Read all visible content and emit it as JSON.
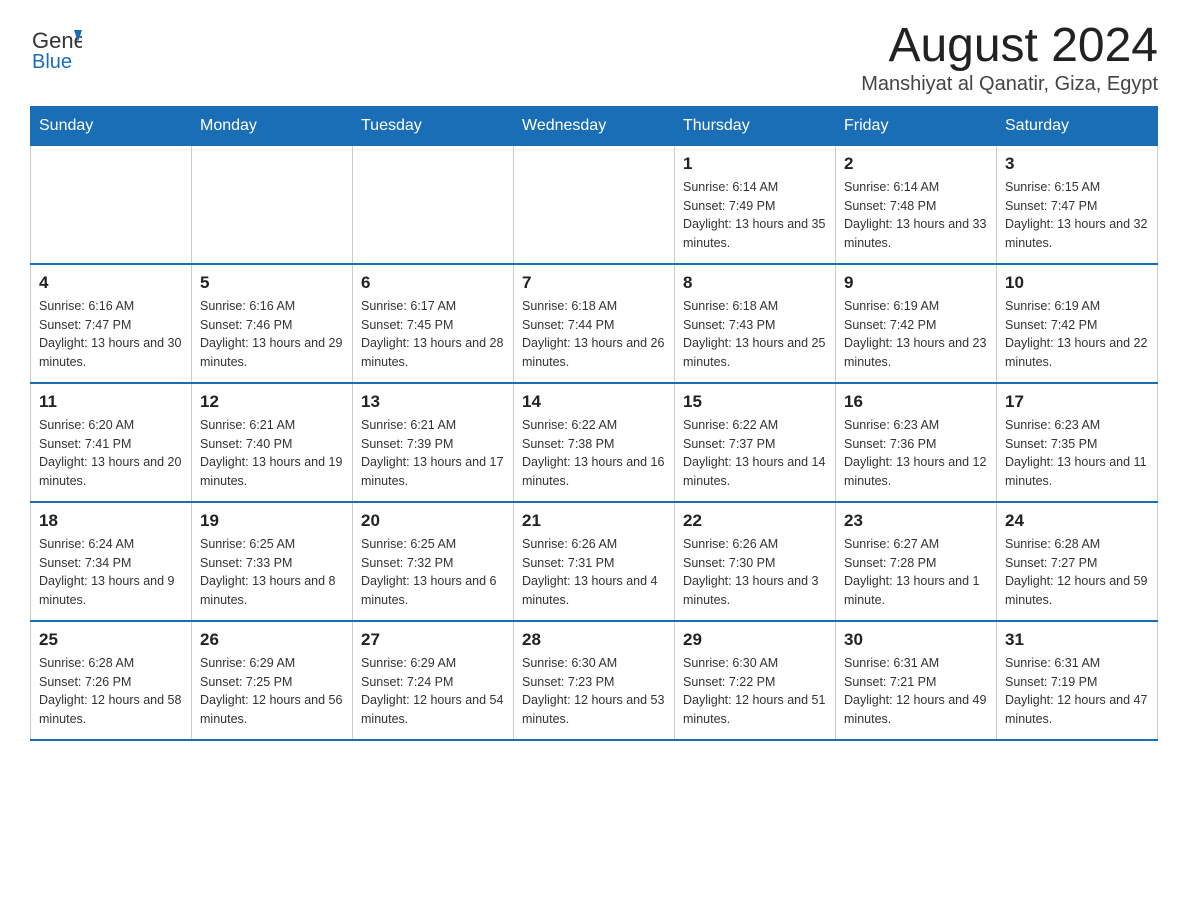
{
  "header": {
    "logo_text_main": "General",
    "logo_text_blue": "Blue",
    "title": "August 2024",
    "subtitle": "Manshiyat al Qanatir, Giza, Egypt"
  },
  "days_of_week": [
    "Sunday",
    "Monday",
    "Tuesday",
    "Wednesday",
    "Thursday",
    "Friday",
    "Saturday"
  ],
  "weeks": [
    [
      {
        "day": "",
        "info": ""
      },
      {
        "day": "",
        "info": ""
      },
      {
        "day": "",
        "info": ""
      },
      {
        "day": "",
        "info": ""
      },
      {
        "day": "1",
        "info": "Sunrise: 6:14 AM\nSunset: 7:49 PM\nDaylight: 13 hours and 35 minutes."
      },
      {
        "day": "2",
        "info": "Sunrise: 6:14 AM\nSunset: 7:48 PM\nDaylight: 13 hours and 33 minutes."
      },
      {
        "day": "3",
        "info": "Sunrise: 6:15 AM\nSunset: 7:47 PM\nDaylight: 13 hours and 32 minutes."
      }
    ],
    [
      {
        "day": "4",
        "info": "Sunrise: 6:16 AM\nSunset: 7:47 PM\nDaylight: 13 hours and 30 minutes."
      },
      {
        "day": "5",
        "info": "Sunrise: 6:16 AM\nSunset: 7:46 PM\nDaylight: 13 hours and 29 minutes."
      },
      {
        "day": "6",
        "info": "Sunrise: 6:17 AM\nSunset: 7:45 PM\nDaylight: 13 hours and 28 minutes."
      },
      {
        "day": "7",
        "info": "Sunrise: 6:18 AM\nSunset: 7:44 PM\nDaylight: 13 hours and 26 minutes."
      },
      {
        "day": "8",
        "info": "Sunrise: 6:18 AM\nSunset: 7:43 PM\nDaylight: 13 hours and 25 minutes."
      },
      {
        "day": "9",
        "info": "Sunrise: 6:19 AM\nSunset: 7:42 PM\nDaylight: 13 hours and 23 minutes."
      },
      {
        "day": "10",
        "info": "Sunrise: 6:19 AM\nSunset: 7:42 PM\nDaylight: 13 hours and 22 minutes."
      }
    ],
    [
      {
        "day": "11",
        "info": "Sunrise: 6:20 AM\nSunset: 7:41 PM\nDaylight: 13 hours and 20 minutes."
      },
      {
        "day": "12",
        "info": "Sunrise: 6:21 AM\nSunset: 7:40 PM\nDaylight: 13 hours and 19 minutes."
      },
      {
        "day": "13",
        "info": "Sunrise: 6:21 AM\nSunset: 7:39 PM\nDaylight: 13 hours and 17 minutes."
      },
      {
        "day": "14",
        "info": "Sunrise: 6:22 AM\nSunset: 7:38 PM\nDaylight: 13 hours and 16 minutes."
      },
      {
        "day": "15",
        "info": "Sunrise: 6:22 AM\nSunset: 7:37 PM\nDaylight: 13 hours and 14 minutes."
      },
      {
        "day": "16",
        "info": "Sunrise: 6:23 AM\nSunset: 7:36 PM\nDaylight: 13 hours and 12 minutes."
      },
      {
        "day": "17",
        "info": "Sunrise: 6:23 AM\nSunset: 7:35 PM\nDaylight: 13 hours and 11 minutes."
      }
    ],
    [
      {
        "day": "18",
        "info": "Sunrise: 6:24 AM\nSunset: 7:34 PM\nDaylight: 13 hours and 9 minutes."
      },
      {
        "day": "19",
        "info": "Sunrise: 6:25 AM\nSunset: 7:33 PM\nDaylight: 13 hours and 8 minutes."
      },
      {
        "day": "20",
        "info": "Sunrise: 6:25 AM\nSunset: 7:32 PM\nDaylight: 13 hours and 6 minutes."
      },
      {
        "day": "21",
        "info": "Sunrise: 6:26 AM\nSunset: 7:31 PM\nDaylight: 13 hours and 4 minutes."
      },
      {
        "day": "22",
        "info": "Sunrise: 6:26 AM\nSunset: 7:30 PM\nDaylight: 13 hours and 3 minutes."
      },
      {
        "day": "23",
        "info": "Sunrise: 6:27 AM\nSunset: 7:28 PM\nDaylight: 13 hours and 1 minute."
      },
      {
        "day": "24",
        "info": "Sunrise: 6:28 AM\nSunset: 7:27 PM\nDaylight: 12 hours and 59 minutes."
      }
    ],
    [
      {
        "day": "25",
        "info": "Sunrise: 6:28 AM\nSunset: 7:26 PM\nDaylight: 12 hours and 58 minutes."
      },
      {
        "day": "26",
        "info": "Sunrise: 6:29 AM\nSunset: 7:25 PM\nDaylight: 12 hours and 56 minutes."
      },
      {
        "day": "27",
        "info": "Sunrise: 6:29 AM\nSunset: 7:24 PM\nDaylight: 12 hours and 54 minutes."
      },
      {
        "day": "28",
        "info": "Sunrise: 6:30 AM\nSunset: 7:23 PM\nDaylight: 12 hours and 53 minutes."
      },
      {
        "day": "29",
        "info": "Sunrise: 6:30 AM\nSunset: 7:22 PM\nDaylight: 12 hours and 51 minutes."
      },
      {
        "day": "30",
        "info": "Sunrise: 6:31 AM\nSunset: 7:21 PM\nDaylight: 12 hours and 49 minutes."
      },
      {
        "day": "31",
        "info": "Sunrise: 6:31 AM\nSunset: 7:19 PM\nDaylight: 12 hours and 47 minutes."
      }
    ]
  ]
}
